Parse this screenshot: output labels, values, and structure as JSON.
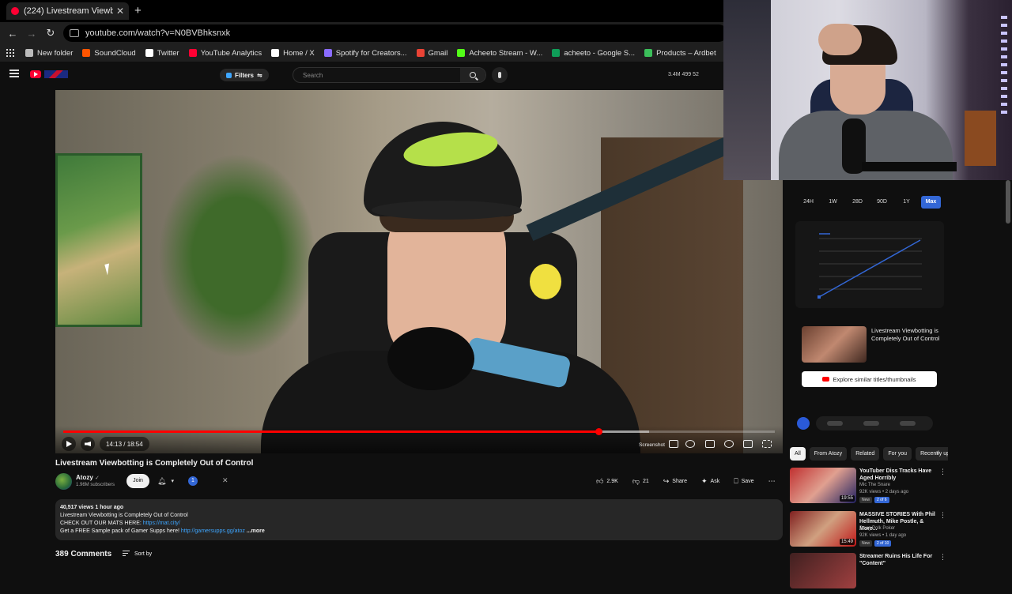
{
  "browser": {
    "tab_title": "(224) Livestream Viewbotting is",
    "url": "youtube.com/watch?v=N0BVBhksnxk",
    "bookmarks": [
      {
        "label": "New folder",
        "color": "#bbbbbb"
      },
      {
        "label": "SoundCloud",
        "color": "#ff5500"
      },
      {
        "label": "Twitter",
        "color": "#ffffff"
      },
      {
        "label": "YouTube Analytics",
        "color": "#ff0033"
      },
      {
        "label": "Home / X",
        "color": "#ffffff"
      },
      {
        "label": "Spotify for Creators...",
        "color": "#8a6cff"
      },
      {
        "label": "Gmail",
        "color": "#ea4335"
      },
      {
        "label": "Acheeto Stream - W...",
        "color": "#53fc18"
      },
      {
        "label": "acheeto - Google S...",
        "color": "#0f9d58"
      },
      {
        "label": "Products – Ardbet",
        "color": "#3bbf5a"
      }
    ]
  },
  "header": {
    "filters_label": "Filters",
    "search_placeholder": "Search",
    "stats": "3.4M   499   52"
  },
  "player": {
    "time": "14:13 / 18:54",
    "screenshot_label": "Screenshot",
    "played_fraction": 0.752,
    "loaded_fraction": 0.823
  },
  "video": {
    "title": "Livestream Viewbotting is Completely Out of Control",
    "channel": "Atozy",
    "subscribers": "1.96M subscribers",
    "join_label": "Join",
    "info_badge": "1",
    "likes": "2.9K",
    "dislikes": "21",
    "share_label": "Share",
    "ask_label": "Ask",
    "save_label": "Save"
  },
  "description": {
    "meta": "40,517 views  1 hour ago",
    "line1": "Livestream Viewbotting is Completely Out of Control",
    "line2_prefix": "CHECK OUT OUR MATS HERE: ",
    "line2_link": "https://mat.city/",
    "line3_prefix": "Get a FREE Sample pack of Gamer Supps here! ",
    "line3_link": "http://gamersupps.gg/atoz",
    "more": "...more"
  },
  "comments": {
    "count_label": "389 Comments",
    "sort_label": "Sort by"
  },
  "extension": {
    "ranges": [
      "24H",
      "1W",
      "28D",
      "90D",
      "1Y",
      "Max"
    ],
    "active_range": "Max",
    "thumb_title": "Livestream Viewbotting is Completely Out of Control",
    "explore_label": "Explore similar titles/thumbnails"
  },
  "chips": [
    "All",
    "From Atozy",
    "Related",
    "For you",
    "Recently uploaded"
  ],
  "recommendations": [
    {
      "title": "YouTuber Diss Tracks Have Aged Horribly",
      "channel": "Mic The Snare",
      "meta": "92K views • 2 days ago",
      "duration": "19:55",
      "badges": [
        "New",
        "2 of 6"
      ],
      "thumb": "linear-gradient(135deg,#c03030,#e0a090 50%,#202060)"
    },
    {
      "title": "MASSIVE STORIES With Phil Hellmuth, Mike Postle, & More...",
      "channel": "Doug Polk Poker",
      "meta": "92K views • 1 day ago",
      "duration": "15:49",
      "badges": [
        "New",
        "2 of 10"
      ],
      "thumb": "linear-gradient(135deg,#802020,#d0a080 50%,#c01818)"
    },
    {
      "title": "Streamer Ruins His Life For \"Content\"",
      "channel": "",
      "meta": "",
      "duration": "",
      "badges": [],
      "thumb": "linear-gradient(135deg,#402020,#a04040)"
    }
  ]
}
